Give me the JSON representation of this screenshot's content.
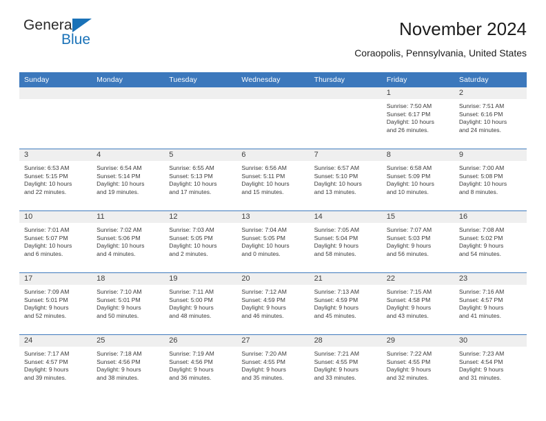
{
  "brand": {
    "name_part1": "General",
    "name_part2": "Blue",
    "triangle_color": "#1a72b8",
    "text_color": "#2b2b2b"
  },
  "header": {
    "title": "November 2024",
    "subtitle": "Coraopolis, Pennsylvania, United States"
  },
  "theme": {
    "header_blue": "#3c78bc",
    "daynum_band": "#efefef",
    "text": "#3a3a3a"
  },
  "calendar": {
    "weekdays": [
      "Sunday",
      "Monday",
      "Tuesday",
      "Wednesday",
      "Thursday",
      "Friday",
      "Saturday"
    ],
    "weeks": [
      [
        {
          "day": "",
          "empty": true,
          "sunrise": "",
          "sunset": "",
          "daylight_line1": "",
          "daylight_line2": ""
        },
        {
          "day": "",
          "empty": true,
          "sunrise": "",
          "sunset": "",
          "daylight_line1": "",
          "daylight_line2": ""
        },
        {
          "day": "",
          "empty": true,
          "sunrise": "",
          "sunset": "",
          "daylight_line1": "",
          "daylight_line2": ""
        },
        {
          "day": "",
          "empty": true,
          "sunrise": "",
          "sunset": "",
          "daylight_line1": "",
          "daylight_line2": ""
        },
        {
          "day": "",
          "empty": true,
          "sunrise": "",
          "sunset": "",
          "daylight_line1": "",
          "daylight_line2": ""
        },
        {
          "day": "1",
          "empty": false,
          "sunrise": "Sunrise: 7:50 AM",
          "sunset": "Sunset: 6:17 PM",
          "daylight_line1": "Daylight: 10 hours",
          "daylight_line2": "and 26 minutes."
        },
        {
          "day": "2",
          "empty": false,
          "sunrise": "Sunrise: 7:51 AM",
          "sunset": "Sunset: 6:16 PM",
          "daylight_line1": "Daylight: 10 hours",
          "daylight_line2": "and 24 minutes."
        }
      ],
      [
        {
          "day": "3",
          "empty": false,
          "sunrise": "Sunrise: 6:53 AM",
          "sunset": "Sunset: 5:15 PM",
          "daylight_line1": "Daylight: 10 hours",
          "daylight_line2": "and 22 minutes."
        },
        {
          "day": "4",
          "empty": false,
          "sunrise": "Sunrise: 6:54 AM",
          "sunset": "Sunset: 5:14 PM",
          "daylight_line1": "Daylight: 10 hours",
          "daylight_line2": "and 19 minutes."
        },
        {
          "day": "5",
          "empty": false,
          "sunrise": "Sunrise: 6:55 AM",
          "sunset": "Sunset: 5:13 PM",
          "daylight_line1": "Daylight: 10 hours",
          "daylight_line2": "and 17 minutes."
        },
        {
          "day": "6",
          "empty": false,
          "sunrise": "Sunrise: 6:56 AM",
          "sunset": "Sunset: 5:11 PM",
          "daylight_line1": "Daylight: 10 hours",
          "daylight_line2": "and 15 minutes."
        },
        {
          "day": "7",
          "empty": false,
          "sunrise": "Sunrise: 6:57 AM",
          "sunset": "Sunset: 5:10 PM",
          "daylight_line1": "Daylight: 10 hours",
          "daylight_line2": "and 13 minutes."
        },
        {
          "day": "8",
          "empty": false,
          "sunrise": "Sunrise: 6:58 AM",
          "sunset": "Sunset: 5:09 PM",
          "daylight_line1": "Daylight: 10 hours",
          "daylight_line2": "and 10 minutes."
        },
        {
          "day": "9",
          "empty": false,
          "sunrise": "Sunrise: 7:00 AM",
          "sunset": "Sunset: 5:08 PM",
          "daylight_line1": "Daylight: 10 hours",
          "daylight_line2": "and 8 minutes."
        }
      ],
      [
        {
          "day": "10",
          "empty": false,
          "sunrise": "Sunrise: 7:01 AM",
          "sunset": "Sunset: 5:07 PM",
          "daylight_line1": "Daylight: 10 hours",
          "daylight_line2": "and 6 minutes."
        },
        {
          "day": "11",
          "empty": false,
          "sunrise": "Sunrise: 7:02 AM",
          "sunset": "Sunset: 5:06 PM",
          "daylight_line1": "Daylight: 10 hours",
          "daylight_line2": "and 4 minutes."
        },
        {
          "day": "12",
          "empty": false,
          "sunrise": "Sunrise: 7:03 AM",
          "sunset": "Sunset: 5:05 PM",
          "daylight_line1": "Daylight: 10 hours",
          "daylight_line2": "and 2 minutes."
        },
        {
          "day": "13",
          "empty": false,
          "sunrise": "Sunrise: 7:04 AM",
          "sunset": "Sunset: 5:05 PM",
          "daylight_line1": "Daylight: 10 hours",
          "daylight_line2": "and 0 minutes."
        },
        {
          "day": "14",
          "empty": false,
          "sunrise": "Sunrise: 7:05 AM",
          "sunset": "Sunset: 5:04 PM",
          "daylight_line1": "Daylight: 9 hours",
          "daylight_line2": "and 58 minutes."
        },
        {
          "day": "15",
          "empty": false,
          "sunrise": "Sunrise: 7:07 AM",
          "sunset": "Sunset: 5:03 PM",
          "daylight_line1": "Daylight: 9 hours",
          "daylight_line2": "and 56 minutes."
        },
        {
          "day": "16",
          "empty": false,
          "sunrise": "Sunrise: 7:08 AM",
          "sunset": "Sunset: 5:02 PM",
          "daylight_line1": "Daylight: 9 hours",
          "daylight_line2": "and 54 minutes."
        }
      ],
      [
        {
          "day": "17",
          "empty": false,
          "sunrise": "Sunrise: 7:09 AM",
          "sunset": "Sunset: 5:01 PM",
          "daylight_line1": "Daylight: 9 hours",
          "daylight_line2": "and 52 minutes."
        },
        {
          "day": "18",
          "empty": false,
          "sunrise": "Sunrise: 7:10 AM",
          "sunset": "Sunset: 5:01 PM",
          "daylight_line1": "Daylight: 9 hours",
          "daylight_line2": "and 50 minutes."
        },
        {
          "day": "19",
          "empty": false,
          "sunrise": "Sunrise: 7:11 AM",
          "sunset": "Sunset: 5:00 PM",
          "daylight_line1": "Daylight: 9 hours",
          "daylight_line2": "and 48 minutes."
        },
        {
          "day": "20",
          "empty": false,
          "sunrise": "Sunrise: 7:12 AM",
          "sunset": "Sunset: 4:59 PM",
          "daylight_line1": "Daylight: 9 hours",
          "daylight_line2": "and 46 minutes."
        },
        {
          "day": "21",
          "empty": false,
          "sunrise": "Sunrise: 7:13 AM",
          "sunset": "Sunset: 4:59 PM",
          "daylight_line1": "Daylight: 9 hours",
          "daylight_line2": "and 45 minutes."
        },
        {
          "day": "22",
          "empty": false,
          "sunrise": "Sunrise: 7:15 AM",
          "sunset": "Sunset: 4:58 PM",
          "daylight_line1": "Daylight: 9 hours",
          "daylight_line2": "and 43 minutes."
        },
        {
          "day": "23",
          "empty": false,
          "sunrise": "Sunrise: 7:16 AM",
          "sunset": "Sunset: 4:57 PM",
          "daylight_line1": "Daylight: 9 hours",
          "daylight_line2": "and 41 minutes."
        }
      ],
      [
        {
          "day": "24",
          "empty": false,
          "sunrise": "Sunrise: 7:17 AM",
          "sunset": "Sunset: 4:57 PM",
          "daylight_line1": "Daylight: 9 hours",
          "daylight_line2": "and 39 minutes."
        },
        {
          "day": "25",
          "empty": false,
          "sunrise": "Sunrise: 7:18 AM",
          "sunset": "Sunset: 4:56 PM",
          "daylight_line1": "Daylight: 9 hours",
          "daylight_line2": "and 38 minutes."
        },
        {
          "day": "26",
          "empty": false,
          "sunrise": "Sunrise: 7:19 AM",
          "sunset": "Sunset: 4:56 PM",
          "daylight_line1": "Daylight: 9 hours",
          "daylight_line2": "and 36 minutes."
        },
        {
          "day": "27",
          "empty": false,
          "sunrise": "Sunrise: 7:20 AM",
          "sunset": "Sunset: 4:55 PM",
          "daylight_line1": "Daylight: 9 hours",
          "daylight_line2": "and 35 minutes."
        },
        {
          "day": "28",
          "empty": false,
          "sunrise": "Sunrise: 7:21 AM",
          "sunset": "Sunset: 4:55 PM",
          "daylight_line1": "Daylight: 9 hours",
          "daylight_line2": "and 33 minutes."
        },
        {
          "day": "29",
          "empty": false,
          "sunrise": "Sunrise: 7:22 AM",
          "sunset": "Sunset: 4:55 PM",
          "daylight_line1": "Daylight: 9 hours",
          "daylight_line2": "and 32 minutes."
        },
        {
          "day": "30",
          "empty": false,
          "sunrise": "Sunrise: 7:23 AM",
          "sunset": "Sunset: 4:54 PM",
          "daylight_line1": "Daylight: 9 hours",
          "daylight_line2": "and 31 minutes."
        }
      ]
    ]
  }
}
